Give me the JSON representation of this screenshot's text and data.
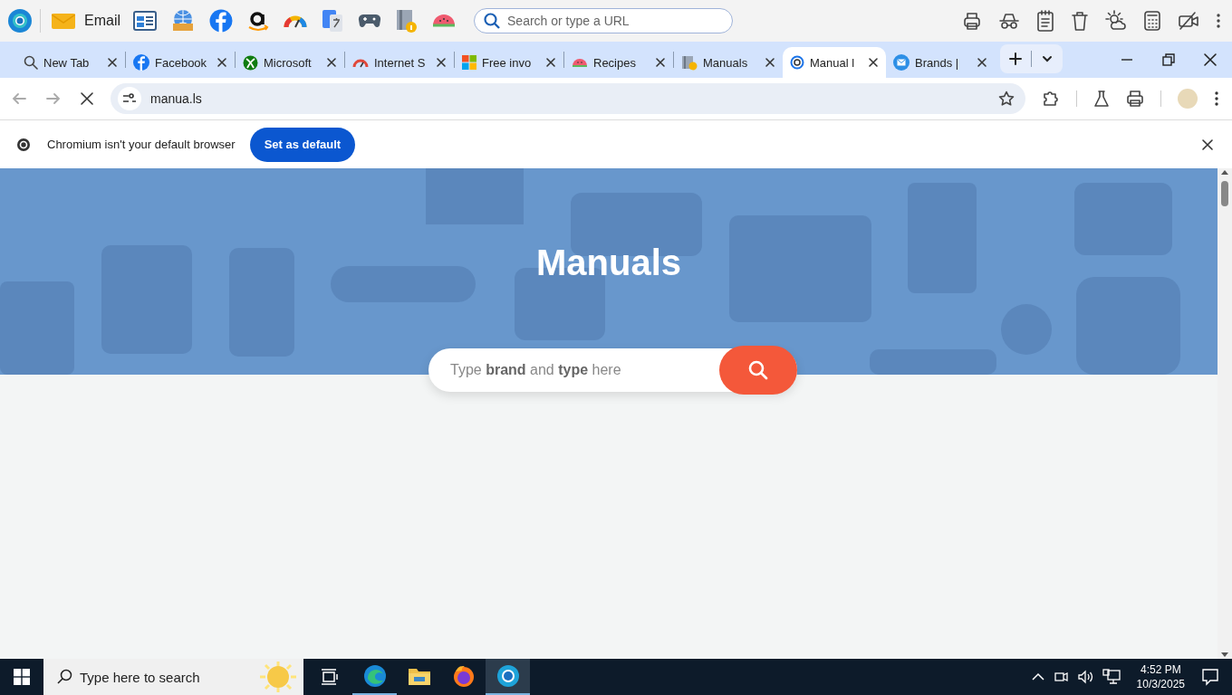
{
  "top_bar": {
    "email_label": "Email",
    "search": {
      "placeholder": "Search or type a URL"
    }
  },
  "tabs": [
    {
      "title": "New Tab",
      "selected": false
    },
    {
      "title": "Facebook",
      "selected": false
    },
    {
      "title": "Microsoft",
      "selected": false
    },
    {
      "title": "Internet S",
      "selected": false
    },
    {
      "title": "Free invo",
      "selected": false
    },
    {
      "title": "Recipes",
      "selected": false
    },
    {
      "title": "Manuals",
      "selected": false
    },
    {
      "title": "Manual l",
      "selected": true
    },
    {
      "title": "Brands |",
      "selected": false
    }
  ],
  "address_bar": {
    "url": "manua.ls",
    "loading": true
  },
  "infobar": {
    "message": "Chromium isn't your default browser",
    "button": "Set as default"
  },
  "page": {
    "title": "Manuals",
    "search": {
      "placeholder": "Type **brand** and **type** here"
    }
  },
  "taskbar": {
    "search_placeholder": "Type here to search",
    "apps": [
      {
        "running": true,
        "selected": false
      },
      {
        "running": false,
        "selected": false
      },
      {
        "running": false,
        "selected": false
      },
      {
        "running": true,
        "selected": true
      }
    ],
    "time": "4:52 PM",
    "date": "10/3/2025"
  }
}
